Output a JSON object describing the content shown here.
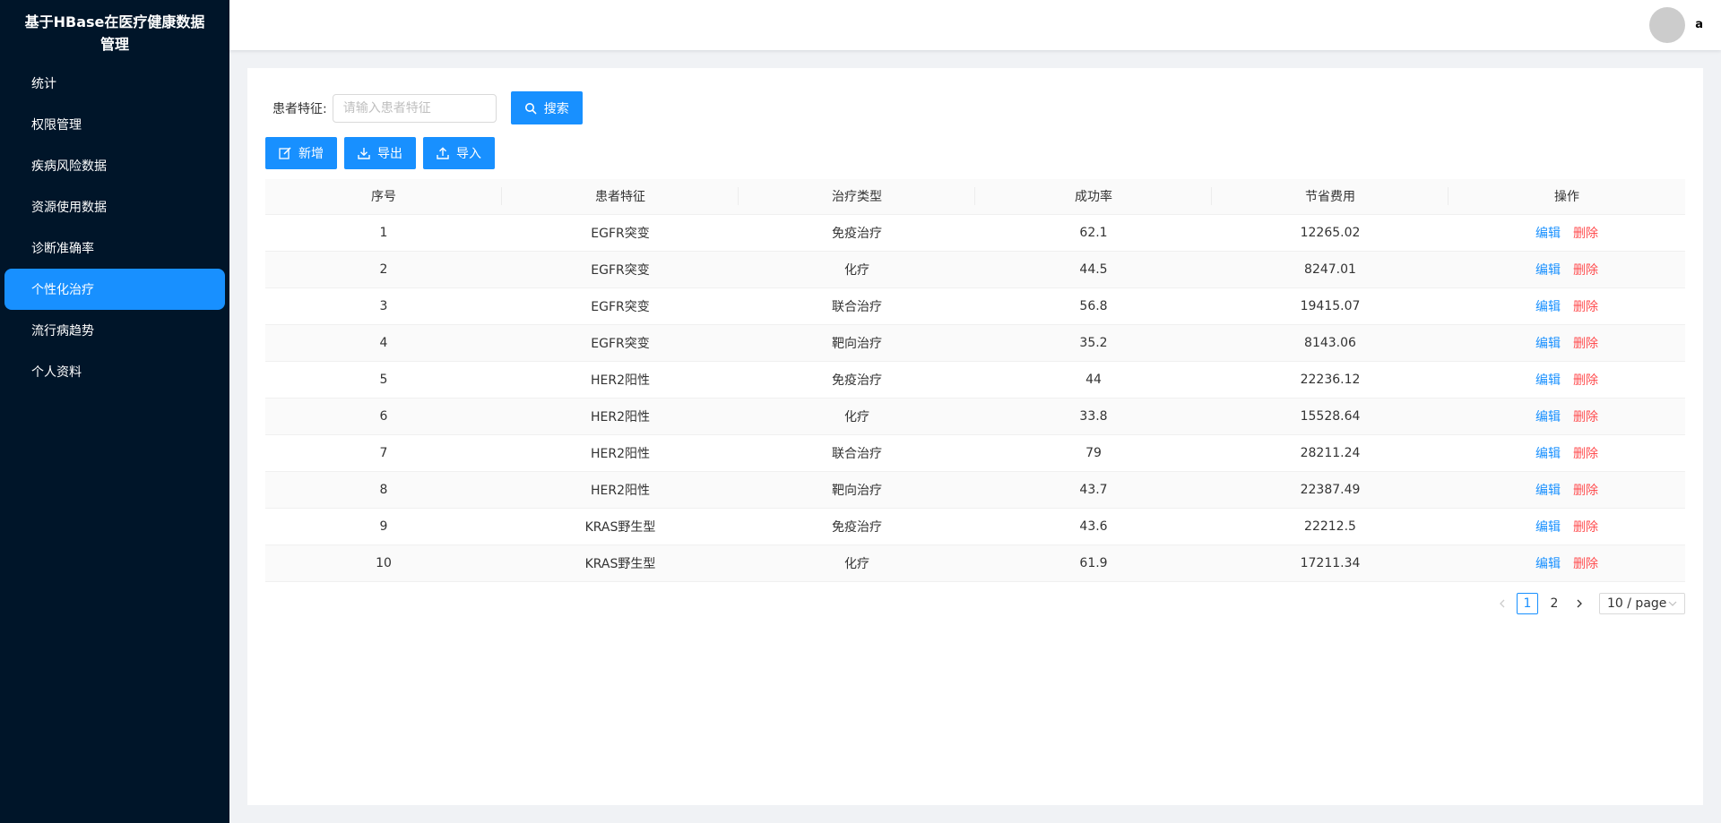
{
  "app": {
    "title": "基于HBase在医疗健康数据管理"
  },
  "sidebar": {
    "items": [
      {
        "label": "统计",
        "active": false
      },
      {
        "label": "权限管理",
        "active": false
      },
      {
        "label": "疾病风险数据",
        "active": false
      },
      {
        "label": "资源使用数据",
        "active": false
      },
      {
        "label": "诊断准确率",
        "active": false
      },
      {
        "label": "个性化治疗",
        "active": true
      },
      {
        "label": "流行病趋势",
        "active": false
      },
      {
        "label": "个人资料",
        "active": false
      }
    ]
  },
  "header": {
    "username": "a"
  },
  "search": {
    "label": "患者特征:",
    "placeholder": "请输入患者特征",
    "value": "",
    "button": "搜索"
  },
  "toolbar": {
    "add": "新增",
    "export": "导出",
    "import": "导入"
  },
  "table": {
    "columns": [
      "序号",
      "患者特征",
      "治疗类型",
      "成功率",
      "节省费用",
      "操作"
    ],
    "rows": [
      [
        "1",
        "EGFR突变",
        "免疫治疗",
        "62.1",
        "12265.02"
      ],
      [
        "2",
        "EGFR突变",
        "化疗",
        "44.5",
        "8247.01"
      ],
      [
        "3",
        "EGFR突变",
        "联合治疗",
        "56.8",
        "19415.07"
      ],
      [
        "4",
        "EGFR突变",
        "靶向治疗",
        "35.2",
        "8143.06"
      ],
      [
        "5",
        "HER2阳性",
        "免疫治疗",
        "44",
        "22236.12"
      ],
      [
        "6",
        "HER2阳性",
        "化疗",
        "33.8",
        "15528.64"
      ],
      [
        "7",
        "HER2阳性",
        "联合治疗",
        "79",
        "28211.24"
      ],
      [
        "8",
        "HER2阳性",
        "靶向治疗",
        "43.7",
        "22387.49"
      ],
      [
        "9",
        "KRAS野生型",
        "免疫治疗",
        "43.6",
        "22212.5"
      ],
      [
        "10",
        "KRAS野生型",
        "化疗",
        "61.9",
        "17211.34"
      ]
    ],
    "edit_label": "编辑",
    "delete_label": "删除"
  },
  "pagination": {
    "pages": [
      "1",
      "2"
    ],
    "current": "1",
    "page_size": "10 / page"
  },
  "colors": {
    "sidebar_bg": "#001529",
    "primary": "#1890ff",
    "danger": "#ff4d4f"
  }
}
